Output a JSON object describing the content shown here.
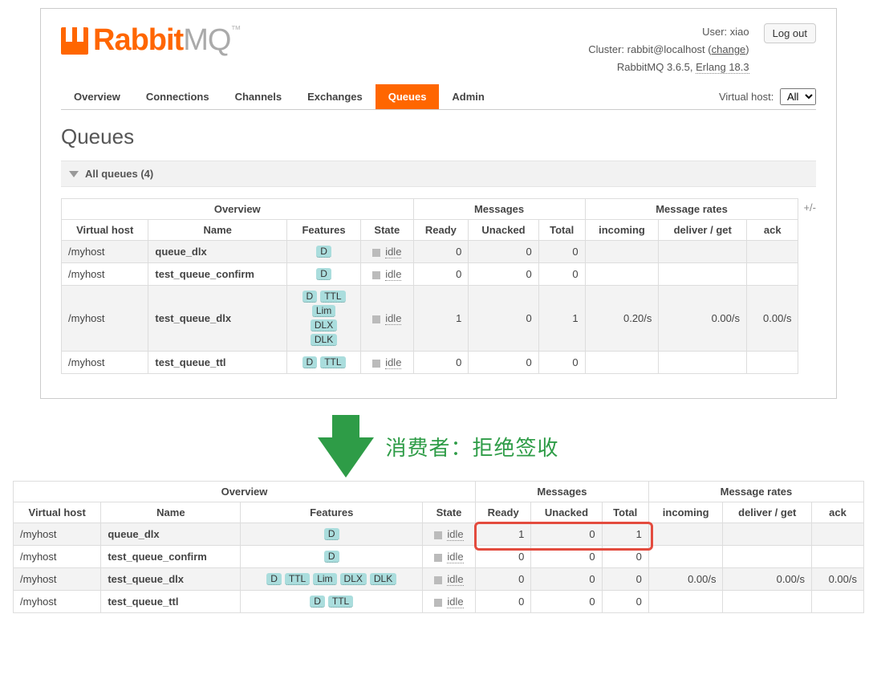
{
  "header": {
    "logo_rabbit": "Rabbit",
    "logo_mq": "MQ",
    "logo_tm": "™",
    "user_label": "User:",
    "user_name": "xiao",
    "cluster_label": "Cluster:",
    "cluster_value": "rabbit@localhost",
    "change_link": "change",
    "product_version": "RabbitMQ 3.6.5",
    "erlang_version": "Erlang 18.3",
    "logout": "Log out"
  },
  "nav": {
    "tabs": [
      "Overview",
      "Connections",
      "Channels",
      "Exchanges",
      "Queues",
      "Admin"
    ],
    "active_index": 4,
    "vhost_label": "Virtual host:",
    "vhost_selected": "All"
  },
  "page": {
    "title": "Queues",
    "section_title": "All queues (4)",
    "plusminus": "+/-"
  },
  "table1": {
    "group_headers": [
      "Overview",
      "Messages",
      "Message rates"
    ],
    "headers": [
      "Virtual host",
      "Name",
      "Features",
      "State",
      "Ready",
      "Unacked",
      "Total",
      "incoming",
      "deliver / get",
      "ack"
    ],
    "rows": [
      {
        "vhost": "/myhost",
        "name": "queue_dlx",
        "features": [
          "D"
        ],
        "state": "idle",
        "ready": "0",
        "unacked": "0",
        "total": "0",
        "incoming": "",
        "deliver": "",
        "ack": ""
      },
      {
        "vhost": "/myhost",
        "name": "test_queue_confirm",
        "features": [
          "D"
        ],
        "state": "idle",
        "ready": "0",
        "unacked": "0",
        "total": "0",
        "incoming": "",
        "deliver": "",
        "ack": ""
      },
      {
        "vhost": "/myhost",
        "name": "test_queue_dlx",
        "features": [
          "D",
          "TTL",
          "Lim",
          "DLX",
          "DLK"
        ],
        "state": "idle",
        "ready": "1",
        "unacked": "0",
        "total": "1",
        "incoming": "0.20/s",
        "deliver": "0.00/s",
        "ack": "0.00/s"
      },
      {
        "vhost": "/myhost",
        "name": "test_queue_ttl",
        "features": [
          "D",
          "TTL"
        ],
        "state": "idle",
        "ready": "0",
        "unacked": "0",
        "total": "0",
        "incoming": "",
        "deliver": "",
        "ack": ""
      }
    ],
    "features_stacked_row_index": 2
  },
  "annotation": "消费者：拒绝签收",
  "table2": {
    "group_headers": [
      "Overview",
      "Messages",
      "Message rates"
    ],
    "headers": [
      "Virtual host",
      "Name",
      "Features",
      "State",
      "Ready",
      "Unacked",
      "Total",
      "incoming",
      "deliver / get",
      "ack"
    ],
    "rows": [
      {
        "vhost": "/myhost",
        "name": "queue_dlx",
        "features": [
          "D"
        ],
        "state": "idle",
        "highlight": true,
        "ready": "1",
        "unacked": "0",
        "total": "1",
        "incoming": "",
        "deliver": "",
        "ack": ""
      },
      {
        "vhost": "/myhost",
        "name": "test_queue_confirm",
        "features": [
          "D"
        ],
        "state": "idle",
        "ready": "0",
        "unacked": "0",
        "total": "0",
        "incoming": "",
        "deliver": "",
        "ack": ""
      },
      {
        "vhost": "/myhost",
        "name": "test_queue_dlx",
        "features": [
          "D",
          "TTL",
          "Lim",
          "DLX",
          "DLK"
        ],
        "state": "idle",
        "ready": "0",
        "unacked": "0",
        "total": "0",
        "incoming": "0.00/s",
        "deliver": "0.00/s",
        "ack": "0.00/s"
      },
      {
        "vhost": "/myhost",
        "name": "test_queue_ttl",
        "features": [
          "D",
          "TTL"
        ],
        "state": "idle",
        "ready": "0",
        "unacked": "0",
        "total": "0",
        "incoming": "",
        "deliver": "",
        "ack": ""
      }
    ]
  }
}
